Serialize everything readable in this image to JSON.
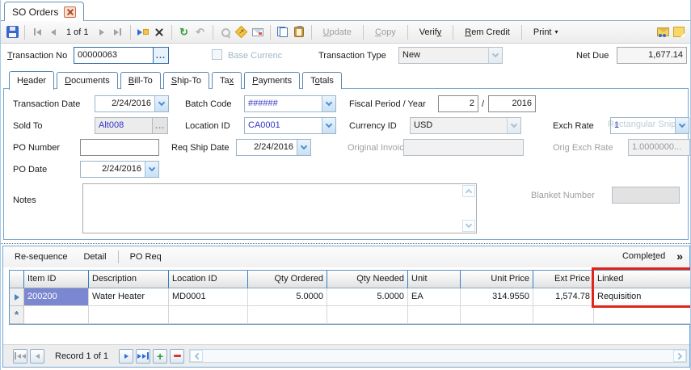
{
  "window": {
    "tab_title": "SO Orders"
  },
  "icons": {
    "lookup": "...",
    "refresh": "↻",
    "undo": "↶",
    "drill_arrow": "↗",
    "print_arrow": "▾",
    "completed_chevrons": "»",
    "new_row_marker": "*"
  },
  "colors": {
    "annotation_red": "#e1251b",
    "selected_cell": "#7b87d0",
    "combo_link_blue": "#3434c8"
  },
  "toolbar": {
    "position": "1 of 1",
    "update": {
      "key": "U",
      "post": "pdate"
    },
    "copy_btn": {
      "key": "C",
      "post": "opy"
    },
    "verify": {
      "pre": "Verif",
      "key": "y",
      "post": ""
    },
    "rem_credit": {
      "key": "R",
      "post": "em Credit"
    },
    "print": "Print"
  },
  "txn": {
    "no_label": {
      "key": "T",
      "post": "ransaction No"
    },
    "no_value": "00000063",
    "base_currency": "Base Currenc",
    "type_label": "Transaction Type",
    "type_value": "New",
    "net_due_label": "Net Due",
    "net_due_value": "1,677.14"
  },
  "tabs": [
    {
      "pre": "H",
      "key": "e",
      "post": "ader"
    },
    {
      "pre": "",
      "key": "D",
      "post": "ocuments"
    },
    {
      "pre": "",
      "key": "B",
      "post": "ill-To"
    },
    {
      "pre": "",
      "key": "S",
      "post": "hip-To"
    },
    {
      "pre": "Ta",
      "key": "x",
      "post": ""
    },
    {
      "pre": "",
      "key": "P",
      "post": "ayments"
    },
    {
      "pre": "T",
      "key": "o",
      "post": "tals"
    }
  ],
  "form": {
    "transaction_date": {
      "label": "Transaction Date",
      "value": "2/24/2016"
    },
    "batch_code": {
      "label": "Batch Code",
      "value": "######"
    },
    "fiscal": {
      "label": "Fiscal Period / Year",
      "period": "2",
      "separator": "/",
      "year": "2016"
    },
    "sold_to": {
      "label": "Sold To",
      "value": "Alt008"
    },
    "location_id": {
      "label": "Location ID",
      "value": "CA0001"
    },
    "currency_id": {
      "label": "Currency ID",
      "value": "USD"
    },
    "exch_rate": {
      "label": "Exch Rate",
      "value": "1"
    },
    "po_number": {
      "label": "PO Number",
      "value": ""
    },
    "req_ship_date": {
      "label": "Req Ship Date",
      "value": "2/24/2016"
    },
    "original_invoice": {
      "label": "Original Invoice",
      "value": ""
    },
    "orig_exch_rate": {
      "label": "Orig Exch Rate",
      "value": "1.0000000..."
    },
    "po_date": {
      "label": "PO Date",
      "value": "2/24/2016"
    },
    "notes": {
      "label": "Notes",
      "value": ""
    },
    "blanket_number": {
      "label": "Blanket Number",
      "value": ""
    }
  },
  "watermark": "Rectangular Snip",
  "detail_bar": {
    "resequence": "Re-sequence",
    "detail": "Detail",
    "po_req": "PO Req",
    "completed": {
      "pre": "Comple",
      "key": "t",
      "post": "ed"
    }
  },
  "grid": {
    "columns": [
      "Item ID",
      "Description",
      "Location ID",
      "Qty Ordered",
      "Qty Needed",
      "Unit",
      "Unit Price",
      "Ext Price",
      "Linked"
    ],
    "row": {
      "item_id": "200200",
      "description": "Water Heater",
      "location_id": "MD0001",
      "qty_ordered": "5.0000",
      "qty_needed": "5.0000",
      "unit": "EA",
      "unit_price": "314.9550",
      "ext_price": "1,574.78",
      "linked": "Requisition"
    }
  },
  "record_nav": {
    "label": "Record 1 of 1"
  }
}
